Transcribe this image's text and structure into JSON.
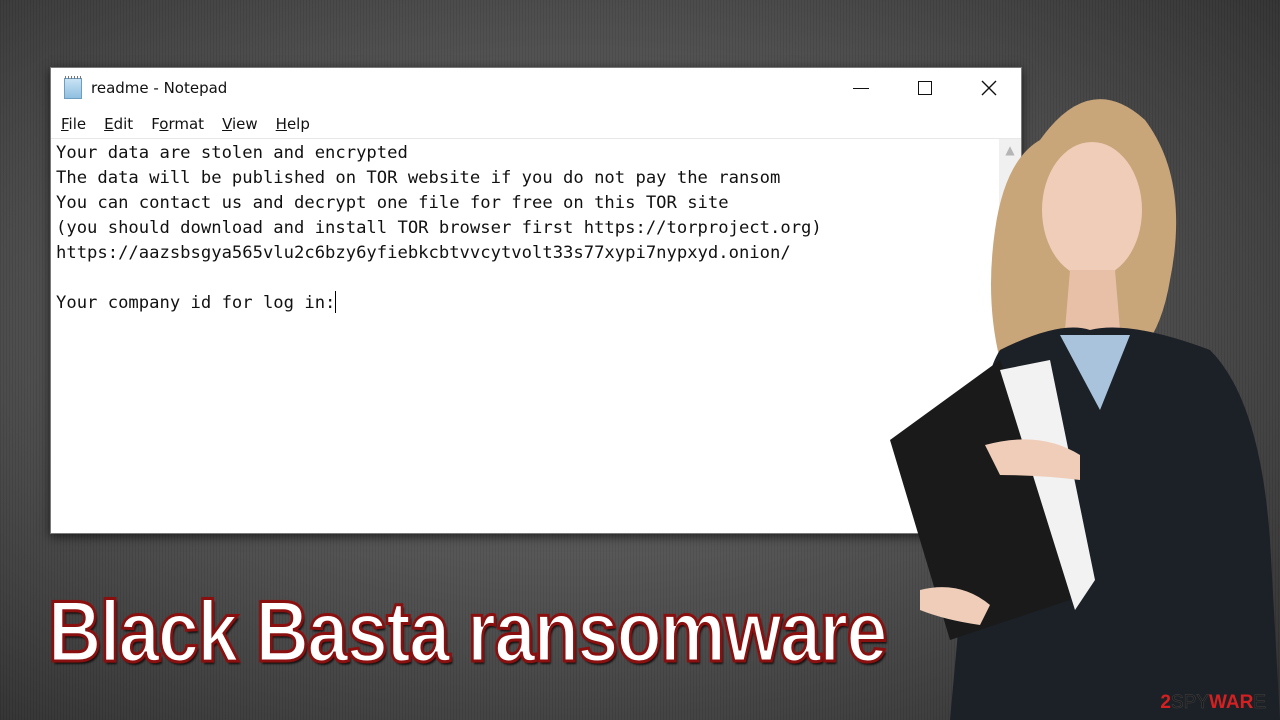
{
  "window": {
    "title": "readme - Notepad",
    "controls": {
      "minimize": "minimize",
      "maximize": "maximize",
      "close": "close"
    }
  },
  "menu": [
    {
      "label": "File",
      "mnemonic": "F",
      "rest": "ile"
    },
    {
      "label": "Edit",
      "mnemonic": "E",
      "rest": "dit"
    },
    {
      "label": "Format",
      "pre": "F",
      "mnemonic": "o",
      "rest": "rmat"
    },
    {
      "label": "View",
      "mnemonic": "V",
      "rest": "iew"
    },
    {
      "label": "Help",
      "mnemonic": "H",
      "rest": "elp"
    }
  ],
  "document": {
    "lines": [
      "Your data are stolen and encrypted",
      "The data will be published on TOR website if you do not pay the ransom",
      "You can contact us and decrypt one file for free on this TOR site",
      "(you should download and install TOR browser first https://torproject.org)",
      "https://aazsbsgya565vlu2c6bzy6yfiebkcbtvvcytvolt33s77xypi7nypxyd.onion/",
      "",
      "Your company id for log in:"
    ]
  },
  "headline": "Black Basta ransomware",
  "watermark": {
    "prefix": "2",
    "middle": "SPY",
    "suffix": "WAR",
    "tail": "E"
  },
  "colors": {
    "accent_red": "#d42020",
    "headline_stroke": "#8a0f0f"
  }
}
